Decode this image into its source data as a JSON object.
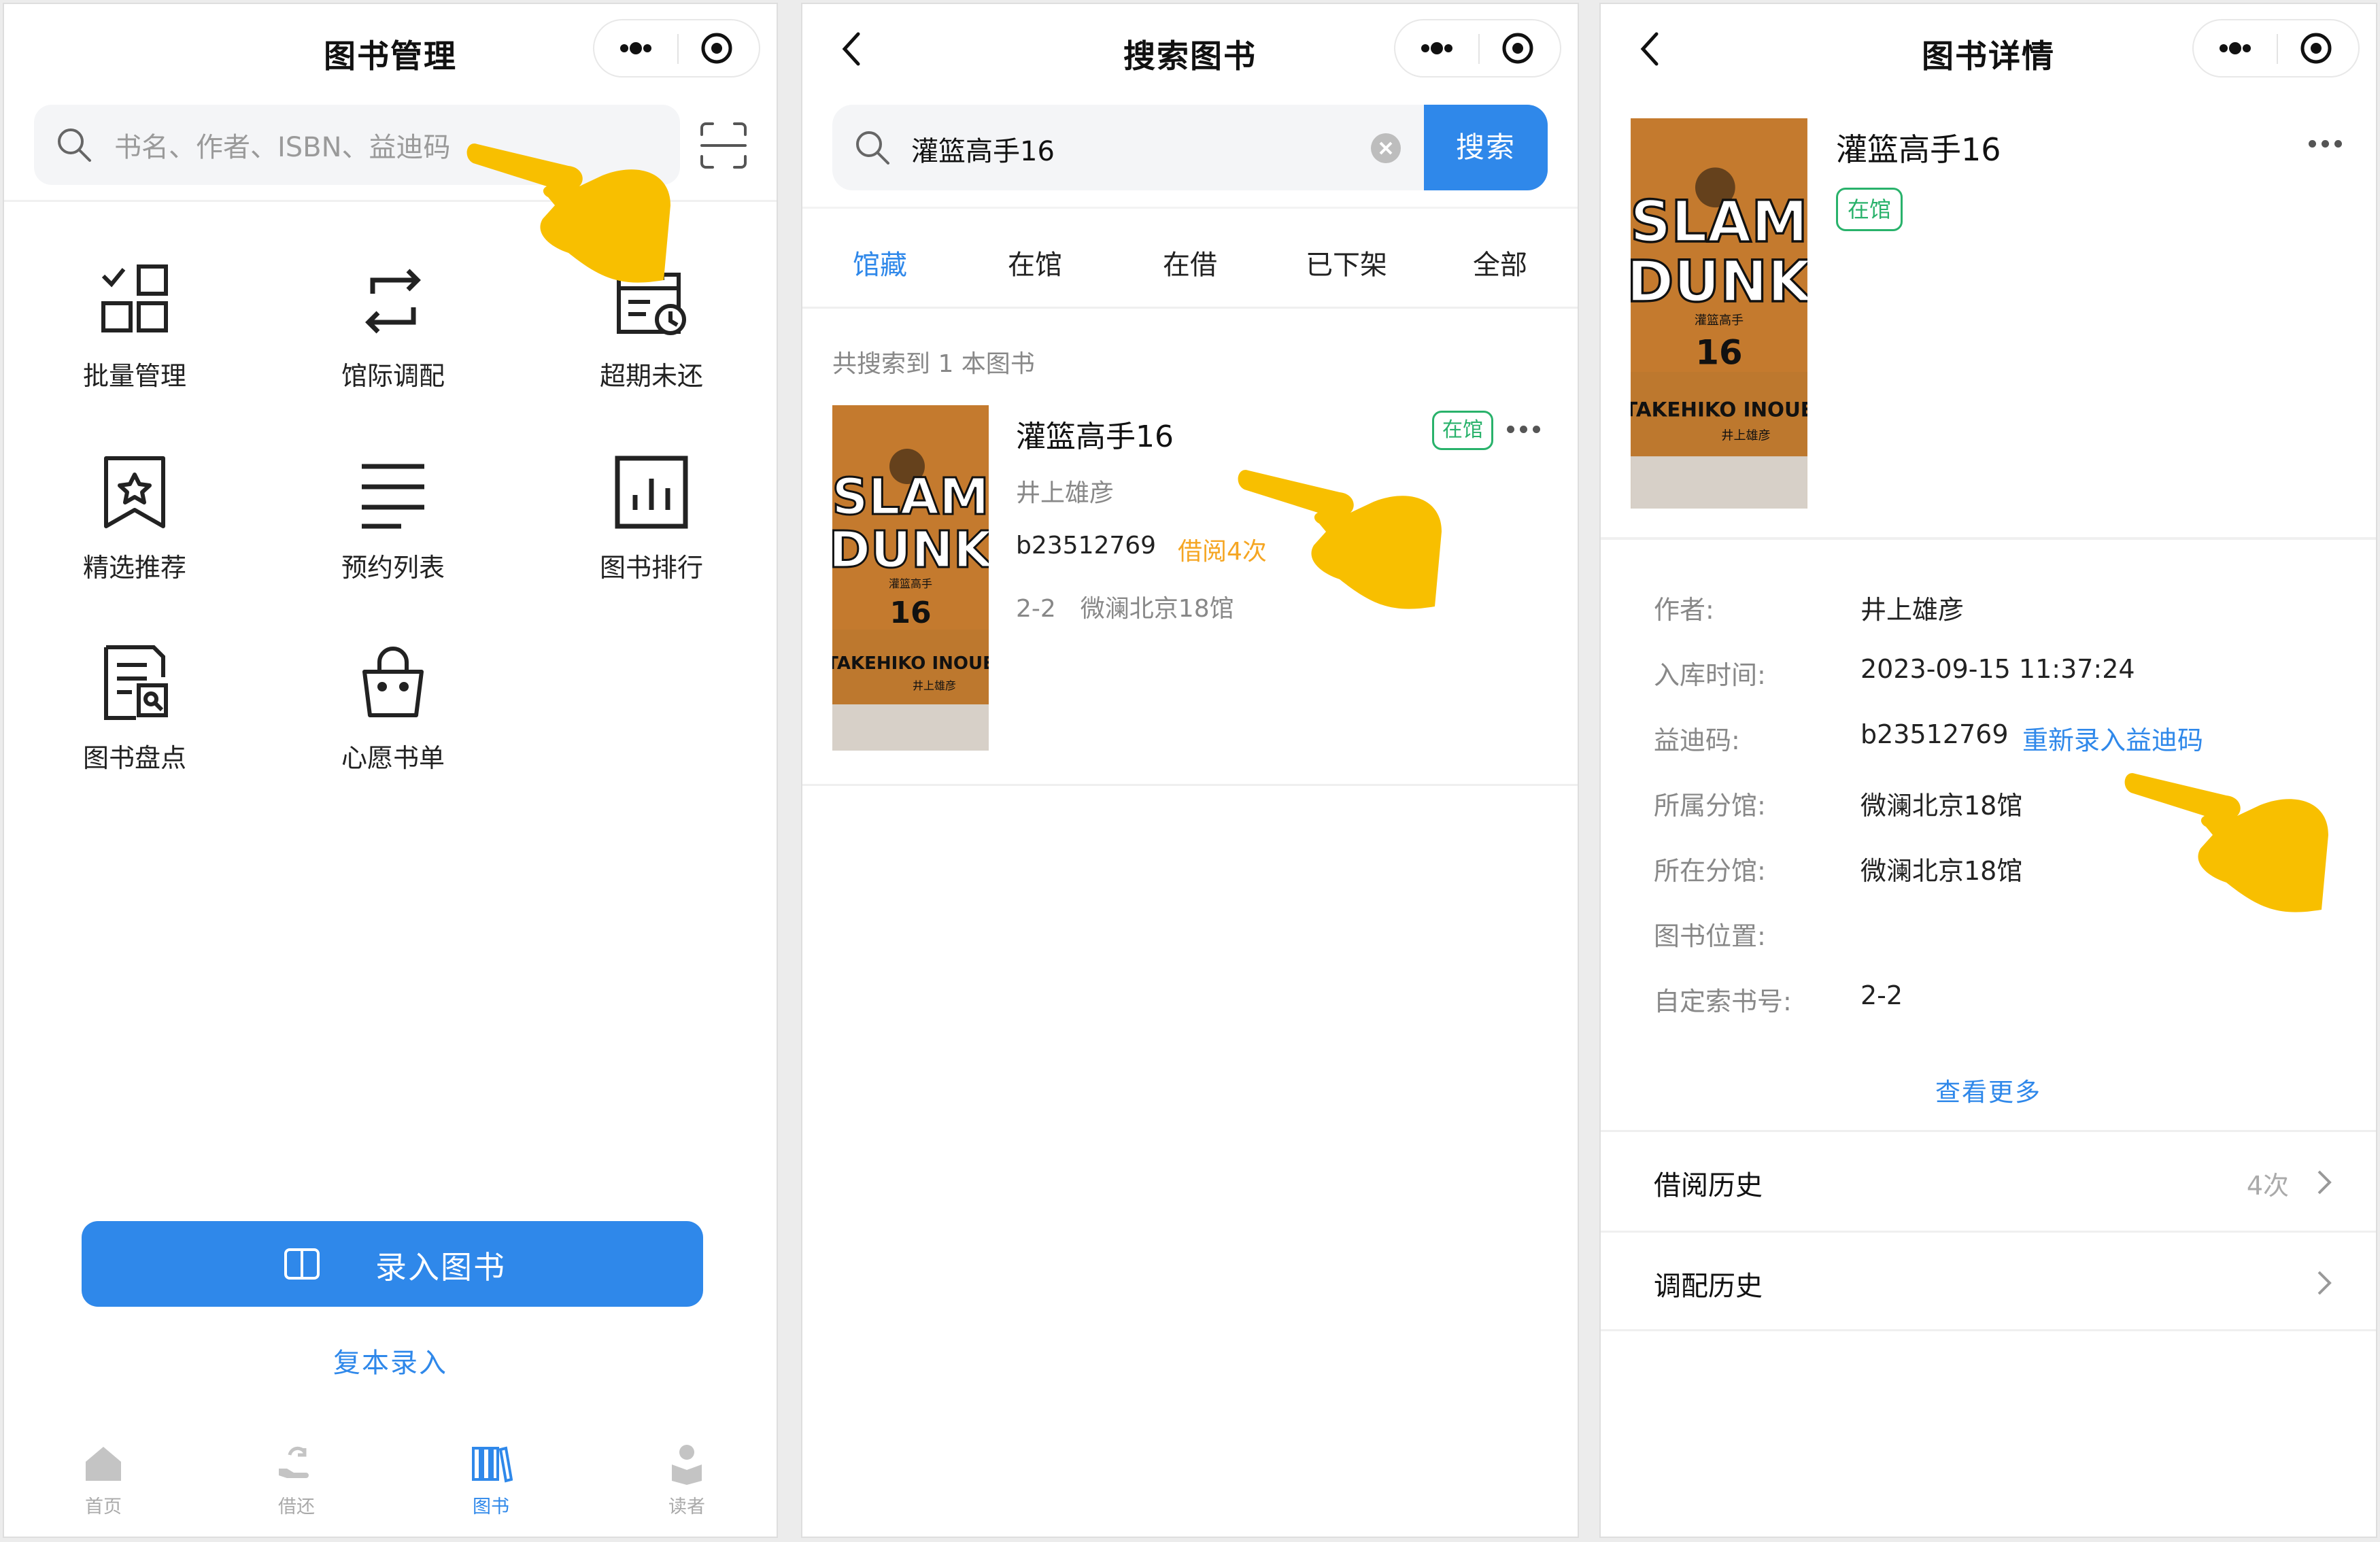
{
  "screen1": {
    "title": "图书管理",
    "search_placeholder": "书名、作者、ISBN、益迪码",
    "grid": [
      {
        "label": "批量管理",
        "icon": "batch-manage-icon"
      },
      {
        "label": "馆际调配",
        "icon": "transfer-icon"
      },
      {
        "label": "超期未还",
        "icon": "overdue-calendar-icon"
      },
      {
        "label": "精选推荐",
        "icon": "star-bookmark-icon"
      },
      {
        "label": "预约列表",
        "icon": "list-lines-icon"
      },
      {
        "label": "图书排行",
        "icon": "bar-chart-icon"
      },
      {
        "label": "图书盘点",
        "icon": "inventory-doc-icon"
      },
      {
        "label": "心愿书单",
        "icon": "shopping-bag-icon"
      }
    ],
    "record_button": "录入图书",
    "copy_link": "复本录入",
    "tabbar": [
      {
        "label": "首页",
        "icon": "home-icon"
      },
      {
        "label": "借还",
        "icon": "hand-return-icon"
      },
      {
        "label": "图书",
        "icon": "books-icon"
      },
      {
        "label": "读者",
        "icon": "reader-icon"
      }
    ],
    "active_tab": 2
  },
  "screen2": {
    "title": "搜索图书",
    "search_value": "灌篮高手16",
    "search_button": "搜索",
    "tabs": [
      "馆藏",
      "在馆",
      "在借",
      "已下架",
      "全部"
    ],
    "active_tab": 0,
    "found_text": "共搜索到 1 本图书",
    "book": {
      "title": "灌篮高手16",
      "status": "在馆",
      "author": "井上雄彦",
      "code": "b23512769",
      "borrow_count": "借阅4次",
      "location": "2-2　微澜北京18馆"
    }
  },
  "screen3": {
    "title": "图书详情",
    "book_title": "灌篮高手16",
    "status": "在馆",
    "rows": [
      {
        "key": "作者:",
        "value": "井上雄彦"
      },
      {
        "key": "入库时间:",
        "value": "2023-09-15 11:37:24"
      },
      {
        "key": "益迪码:",
        "value": "b23512769",
        "link": "重新录入益迪码"
      },
      {
        "key": "所属分馆:",
        "value": "微澜北京18馆"
      },
      {
        "key": "所在分馆:",
        "value": "微澜北京18馆"
      },
      {
        "key": "图书位置:",
        "value": ""
      },
      {
        "key": "自定索书号:",
        "value": "2-2"
      }
    ],
    "see_more": "查看更多",
    "cells": [
      {
        "label": "借阅历史",
        "right": "4次"
      },
      {
        "label": "调配历史",
        "right": ""
      }
    ]
  },
  "cover_text": {
    "line1": "SLAM",
    "line2": "DUNK",
    "small": "灌篮高手",
    "volume": "16",
    "author_en": "TAKEHIKO INOUE",
    "author_cn": "井上雄彦"
  },
  "colors": {
    "primary": "#2f88ea",
    "success": "#29b26b",
    "warning": "#f5a623",
    "hand": "#f8bf00",
    "cover_orange": "#c47a2e"
  }
}
